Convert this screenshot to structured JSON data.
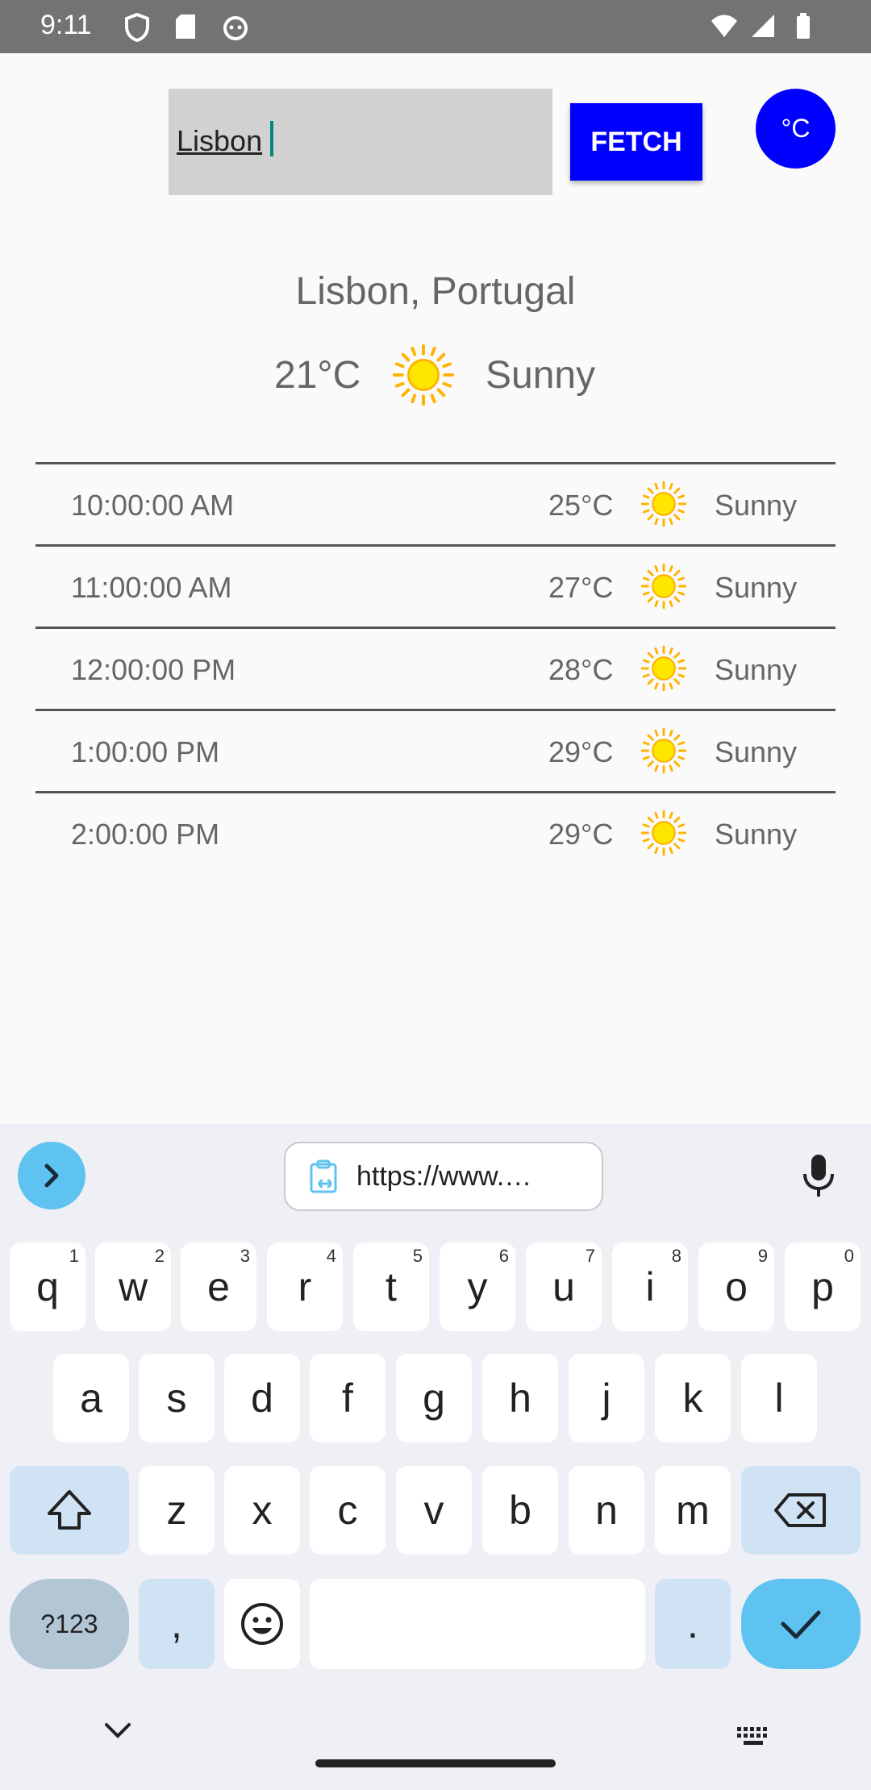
{
  "status_bar": {
    "time": "9:11",
    "icons": [
      "shield-icon",
      "sd-card-icon",
      "cat-face-icon",
      "wifi-icon",
      "signal-icon",
      "battery-icon"
    ]
  },
  "search": {
    "value": "Lisbon",
    "fetch_label": "FETCH",
    "unit_label": "°C"
  },
  "current": {
    "location": "Lisbon, Portugal",
    "temp": "21°C",
    "condition": "Sunny",
    "icon": "sun-icon"
  },
  "forecast": [
    {
      "time": "10:00:00 AM",
      "temp": "25°C",
      "condition": "Sunny",
      "icon": "sun-icon"
    },
    {
      "time": "11:00:00 AM",
      "temp": "27°C",
      "condition": "Sunny",
      "icon": "sun-icon"
    },
    {
      "time": "12:00:00 PM",
      "temp": "28°C",
      "condition": "Sunny",
      "icon": "sun-icon"
    },
    {
      "time": "1:00:00 PM",
      "temp": "29°C",
      "condition": "Sunny",
      "icon": "sun-icon"
    },
    {
      "time": "2:00:00 PM",
      "temp": "29°C",
      "condition": "Sunny",
      "icon": "sun-icon"
    }
  ],
  "keyboard": {
    "clipboard_text": "https://www.…",
    "row1": [
      {
        "k": "q",
        "h": "1"
      },
      {
        "k": "w",
        "h": "2"
      },
      {
        "k": "e",
        "h": "3"
      },
      {
        "k": "r",
        "h": "4"
      },
      {
        "k": "t",
        "h": "5"
      },
      {
        "k": "y",
        "h": "6"
      },
      {
        "k": "u",
        "h": "7"
      },
      {
        "k": "i",
        "h": "8"
      },
      {
        "k": "o",
        "h": "9"
      },
      {
        "k": "p",
        "h": "0"
      }
    ],
    "row2": [
      "a",
      "s",
      "d",
      "f",
      "g",
      "h",
      "j",
      "k",
      "l"
    ],
    "row3": [
      "z",
      "x",
      "c",
      "v",
      "b",
      "n",
      "m"
    ],
    "sym_label": "?123",
    "comma": ",",
    "period": "."
  },
  "colors": {
    "accent": "#0000ff",
    "status_bar": "#737373",
    "input_bg": "#d1d1d1",
    "kb_enter": "#5ec3f0"
  }
}
